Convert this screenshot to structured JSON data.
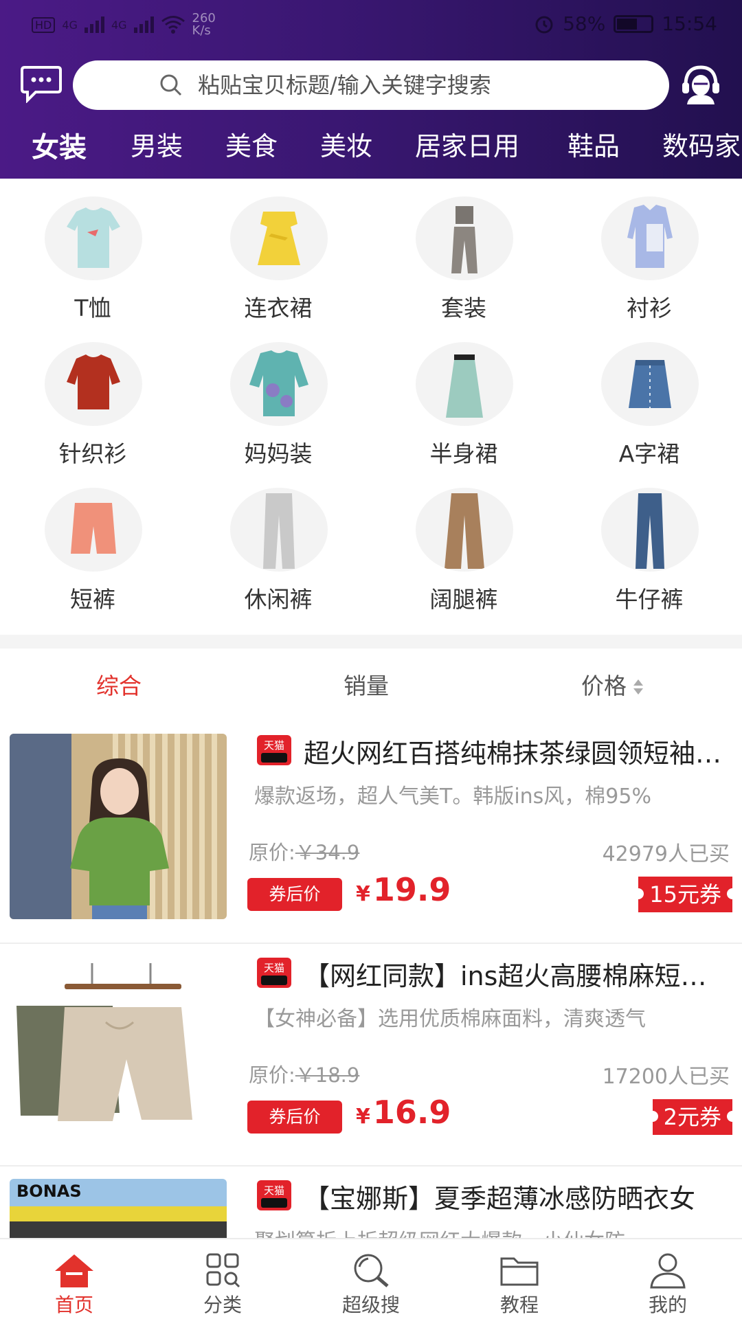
{
  "status_bar": {
    "hd": "HD",
    "net1": "4G",
    "net2": "4G",
    "speed_value": "260",
    "speed_unit": "K/s",
    "battery": "58%",
    "time": "15:54"
  },
  "search": {
    "placeholder": "粘贴宝贝标题/输入关键字搜索"
  },
  "category_tabs": [
    {
      "label": "女装",
      "active": true
    },
    {
      "label": "男装"
    },
    {
      "label": "美食"
    },
    {
      "label": "美妆"
    },
    {
      "label": "居家日用"
    },
    {
      "label": "鞋品"
    },
    {
      "label": "数码家"
    }
  ],
  "subcategories": [
    {
      "label": "T恤"
    },
    {
      "label": "连衣裙"
    },
    {
      "label": "套装"
    },
    {
      "label": "衬衫"
    },
    {
      "label": "针织衫"
    },
    {
      "label": "妈妈装"
    },
    {
      "label": "半身裙"
    },
    {
      "label": "A字裙"
    },
    {
      "label": "短裤"
    },
    {
      "label": "休闲裤"
    },
    {
      "label": "阔腿裤"
    },
    {
      "label": "牛仔裤"
    }
  ],
  "sort": {
    "overall": "综合",
    "sales": "销量",
    "price": "价格"
  },
  "products": [
    {
      "badge": "天猫",
      "title": "超火网红百搭纯棉抹茶绿圆领短袖T恤女",
      "desc": "爆款返场，超人气美T。韩版ins风，棉95%",
      "orig_label": "原价:",
      "orig_price": "￥34.9",
      "sold": "42979人已买",
      "after_label": "券后价",
      "currency": "¥",
      "price": "19.9",
      "coupon": "15元券"
    },
    {
      "badge": "天猫",
      "title": "【网红同款】ins超火高腰棉麻短裤女",
      "desc": "【女神必备】选用优质棉麻面料，清爽透气",
      "orig_label": "原价:",
      "orig_price": "￥18.9",
      "sold": "17200人已买",
      "after_label": "券后价",
      "currency": "¥",
      "price": "16.9",
      "coupon": "2元券"
    },
    {
      "badge": "天猫",
      "title": "【宝娜斯】夏季超薄冰感防晒衣女",
      "desc": "聚划算折上折超级网红大爆款，小仙女防",
      "thumb_brand": "BONAS"
    }
  ],
  "bottom_nav": [
    {
      "label": "首页",
      "active": true
    },
    {
      "label": "分类"
    },
    {
      "label": "超级搜"
    },
    {
      "label": "教程"
    },
    {
      "label": "我的"
    }
  ],
  "colors": {
    "header_start": "#4b1a86",
    "header_end": "#22104f",
    "accent_red": "#e2222a"
  }
}
